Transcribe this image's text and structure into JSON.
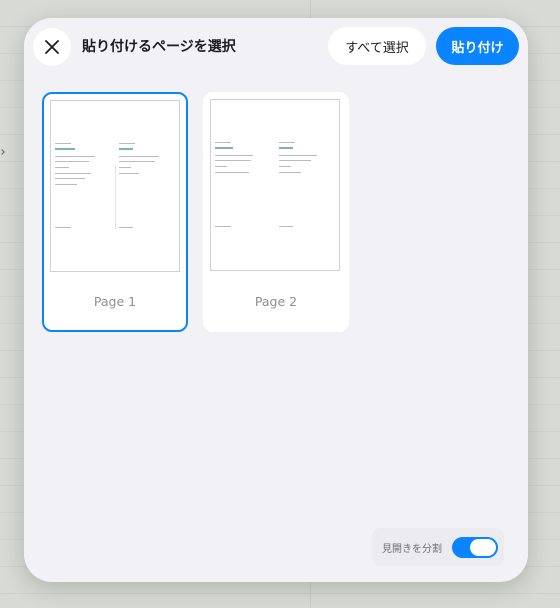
{
  "dialog": {
    "title": "貼り付けるページを選択",
    "close_icon": "close-icon",
    "select_all_label": "すべて選択",
    "paste_label": "貼り付け"
  },
  "pages": [
    {
      "label": "Page 1",
      "selected": true
    },
    {
      "label": "Page 2",
      "selected": false
    }
  ],
  "footer": {
    "toggle_label": "見開きを分割",
    "toggle_on": true
  },
  "colors": {
    "accent": "#0a84ff",
    "dialog_background": "#f2f2f6"
  }
}
